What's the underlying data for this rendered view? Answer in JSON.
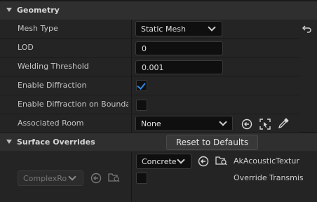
{
  "geometry": {
    "title": "Geometry",
    "mesh_type": {
      "label": "Mesh Type",
      "value": "Static Mesh"
    },
    "lod": {
      "label": "LOD",
      "value": "0"
    },
    "welding_threshold": {
      "label": "Welding Threshold",
      "value": "0.001"
    },
    "enable_diffraction": {
      "label": "Enable Diffraction",
      "checked": true
    },
    "enable_diffraction_boundary": {
      "label": "Enable Diffraction on Bounda...",
      "checked": false
    },
    "associated_room": {
      "label": "Associated Room",
      "value": "None"
    }
  },
  "surface_overrides": {
    "title": "Surface Overrides",
    "reset_button": "Reset to Defaults",
    "material_combo": "ComplexRo",
    "texture_combo": "Concrete",
    "texture_label": "AkAcousticTextur",
    "override_label": "Override Transmis"
  },
  "colors": {
    "accent_check": "#2f8be8"
  }
}
